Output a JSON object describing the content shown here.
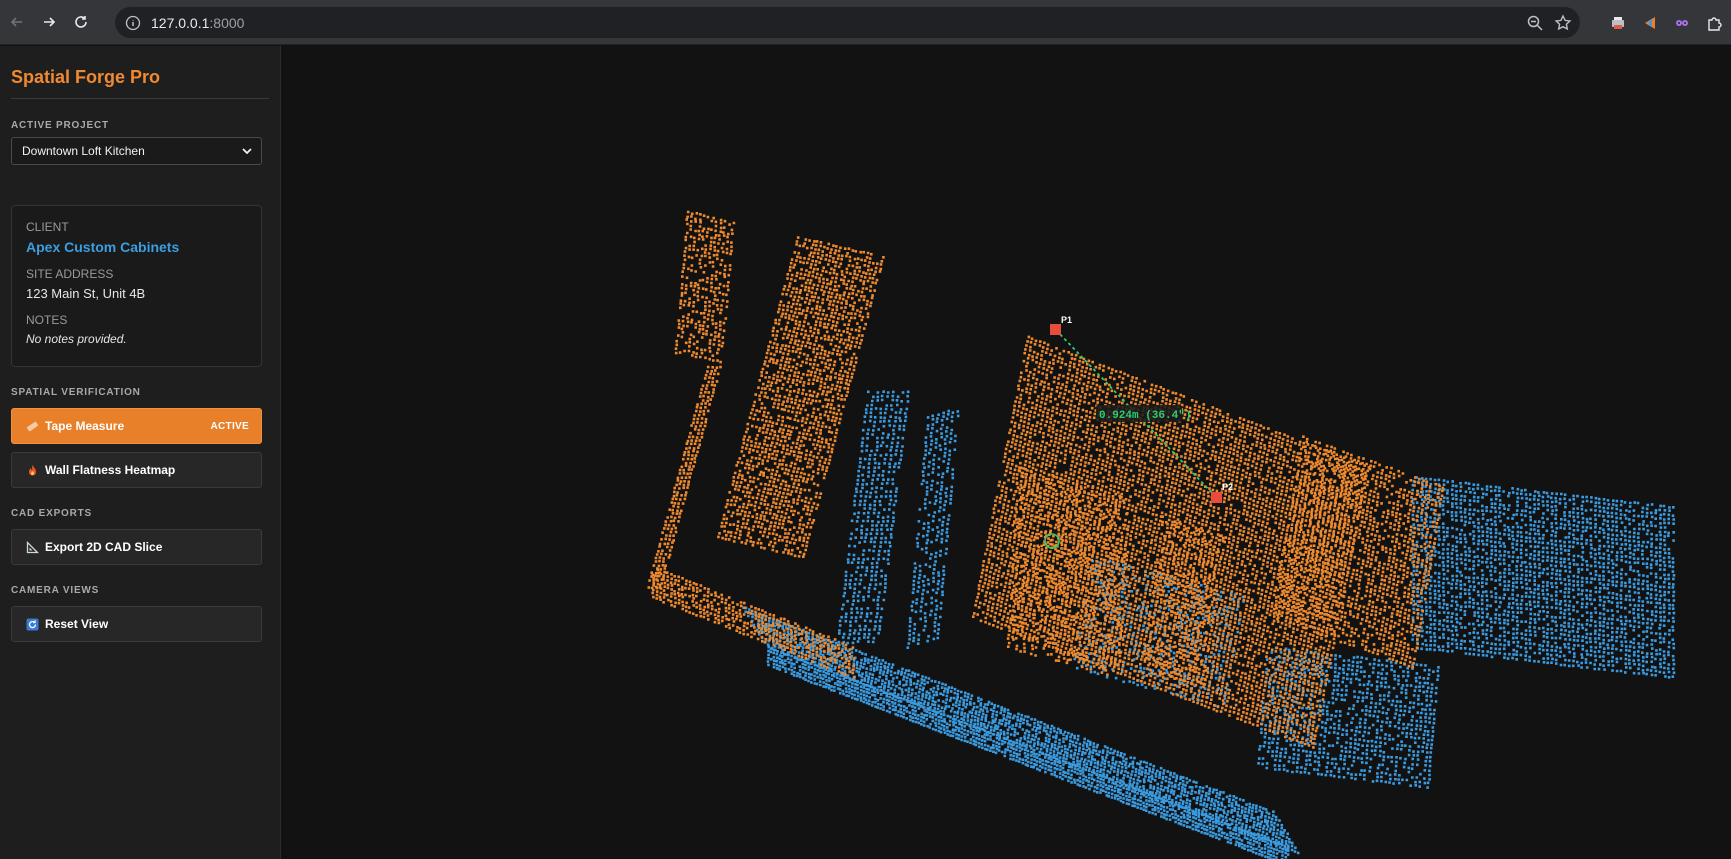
{
  "browser": {
    "url_host": "127.0.0.1",
    "url_port": ":8000"
  },
  "sidebar": {
    "title": "Spatial Forge Pro",
    "active_project_label": "ACTIVE PROJECT",
    "project_selected": "Downtown Loft Kitchen",
    "client_label": "CLIENT",
    "client_name": "Apex Custom Cabinets",
    "site_address_label": "SITE ADDRESS",
    "site_address": "123 Main St, Unit 4B",
    "notes_label": "NOTES",
    "notes": "No notes provided.",
    "spatial_label": "SPATIAL VERIFICATION",
    "tape_measure": "Tape Measure",
    "tape_badge": "ACTIVE",
    "wall_heatmap": "Wall Flatness Heatmap",
    "cad_label": "CAD EXPORTS",
    "export_cad": "Export 2D CAD Slice",
    "camera_label": "CAMERA VIEWS",
    "reset_view": "Reset View"
  },
  "viewport": {
    "measurement_label": "0.924m (36.4\")",
    "point_a_label": "P1",
    "point_b_label": "P2",
    "colors": {
      "orange": "#ef8a2e",
      "blue": "#3a9be0",
      "point": "#e74c3c",
      "measure": "#2ecc71"
    }
  },
  "colors": {
    "accent": "#e8802a",
    "client_blue": "#3b9ee0"
  },
  "icons": {
    "tape": "ruler-icon",
    "heatmap": "flame-icon",
    "cad": "triangle-ruler-icon",
    "reset": "refresh-icon"
  }
}
